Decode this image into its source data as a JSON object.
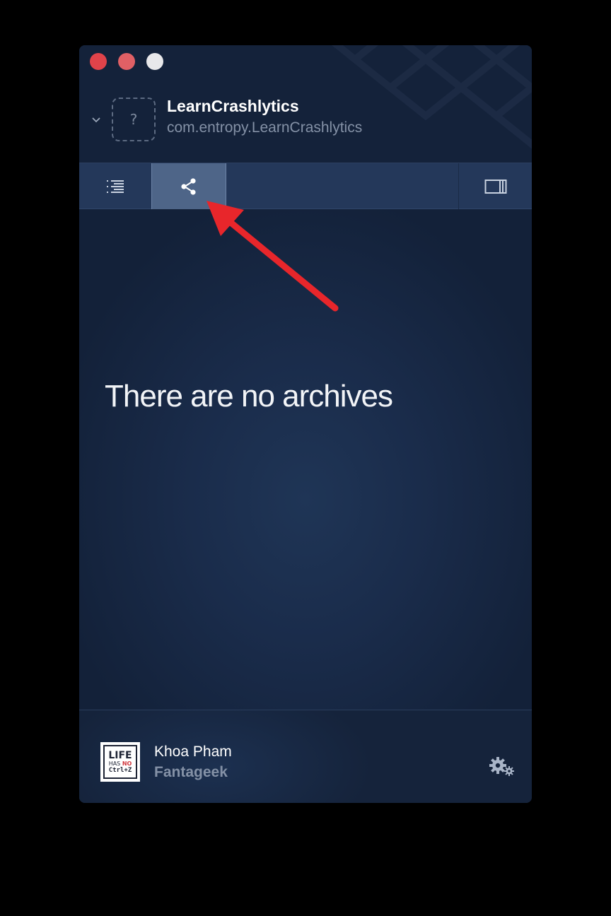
{
  "app": {
    "name": "LearnCrashlytics",
    "bundle_id": "com.entropy.LearnCrashlytics",
    "icon_placeholder": "?"
  },
  "toolbar": {
    "items": [
      {
        "icon": "list-icon",
        "selected": false
      },
      {
        "icon": "share-icon",
        "selected": true
      },
      {
        "icon": "sidebar-panel-icon",
        "selected": false
      }
    ]
  },
  "main": {
    "empty_message": "There are no archives"
  },
  "footer": {
    "user_name": "Khoa Pham",
    "organization": "Fantageek",
    "avatar": {
      "line1": "LIFE",
      "line2_a": "HAS",
      "line2_b": "NO",
      "line3": "Ctrl+Z"
    }
  },
  "colors": {
    "window_bg": "#15233b",
    "toolbar_bg": "#24385a",
    "selected_tab": "#4e6588",
    "annotation_arrow": "#e8262b"
  }
}
